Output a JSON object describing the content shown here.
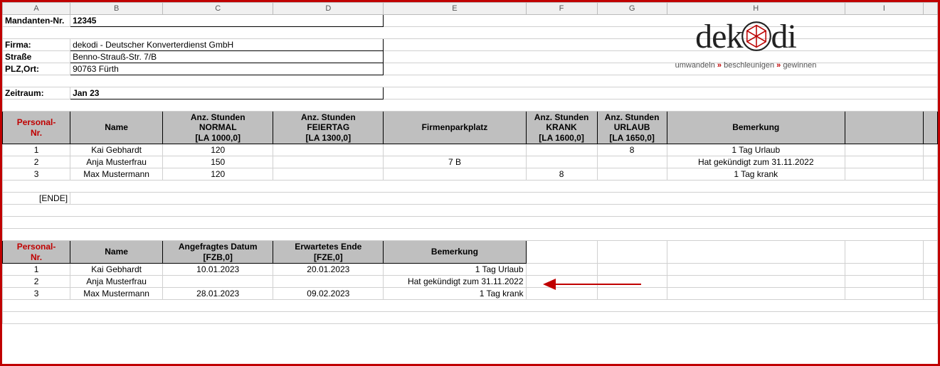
{
  "cols": [
    "A",
    "B",
    "C",
    "D",
    "E",
    "F",
    "G",
    "H",
    "I"
  ],
  "header": {
    "mandant_label": "Mandanten-Nr.",
    "mandant_value": "12345",
    "firma_label": "Firma:",
    "firma_value": "dekodi - Deutscher Konverterdienst GmbH",
    "strasse_label": "Straße",
    "strasse_value": "Benno-Strauß-Str. 7/B",
    "plzort_label": "PLZ,Ort:",
    "plzort_value": "90763 Fürth",
    "zeitraum_label": "Zeitraum:",
    "zeitraum_value": "Jan 23"
  },
  "logo": {
    "word_pre": "dek",
    "word_post": "di",
    "tag1": "umwandeln",
    "tag2": "beschleunigen",
    "tag3": "gewinnen",
    "sep": "»"
  },
  "table1": {
    "headers": {
      "personal": "Personal-\nNr.",
      "name": "Name",
      "normal": "Anz. Stunden\nNORMAL\n[LA 1000,0]",
      "feiertag": "Anz. Stunden\nFEIERTAG\n[LA 1300,0]",
      "parkplatz": "Firmenparkplatz",
      "krank": "Anz. Stunden\nKRANK\n[LA 1600,0]",
      "urlaub": "Anz. Stunden\nURLAUB\n[LA 1650,0]",
      "bemerkung": "Bemerkung"
    },
    "rows": [
      {
        "nr": "1",
        "name": "Kai Gebhardt",
        "normal": "120",
        "feiertag": "",
        "park": "",
        "krank": "",
        "urlaub": "8",
        "bem": "1 Tag Urlaub"
      },
      {
        "nr": "2",
        "name": "Anja Musterfrau",
        "normal": "150",
        "feiertag": "",
        "park": "7 B",
        "krank": "",
        "urlaub": "",
        "bem": "Hat gekündigt zum 31.11.2022"
      },
      {
        "nr": "3",
        "name": "Max Mustermann",
        "normal": "120",
        "feiertag": "",
        "park": "",
        "krank": "8",
        "urlaub": "",
        "bem": "1 Tag krank"
      }
    ]
  },
  "ende": "[ENDE]",
  "table2": {
    "headers": {
      "personal": "Personal-\nNr.",
      "name": "Name",
      "angefragt": "Angefragtes Datum\n[FZB,0]",
      "erwartet": "Erwartetes Ende\n[FZE,0]",
      "bemerkung": "Bemerkung"
    },
    "rows": [
      {
        "nr": "1",
        "name": "Kai Gebhardt",
        "ang": "10.01.2023",
        "erw": "20.01.2023",
        "bem": "1 Tag Urlaub"
      },
      {
        "nr": "2",
        "name": "Anja Musterfrau",
        "ang": "",
        "erw": "",
        "bem": "Hat gekündigt zum 31.11.2022"
      },
      {
        "nr": "3",
        "name": "Max Mustermann",
        "ang": "28.01.2023",
        "erw": "09.02.2023",
        "bem": "1 Tag krank"
      }
    ]
  }
}
